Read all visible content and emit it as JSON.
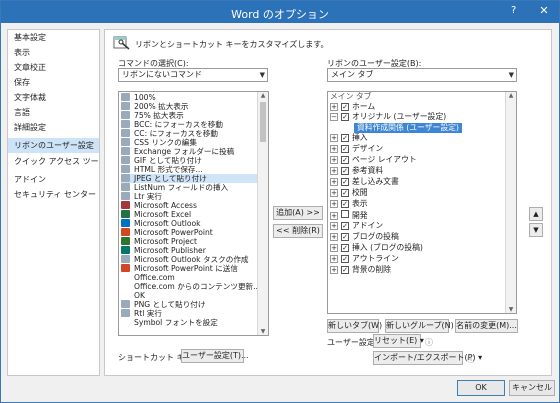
{
  "window": {
    "title": "Word のオプション",
    "help_icon": "?",
    "close_icon": "✕"
  },
  "sidebar": {
    "items": [
      {
        "label": "基本設定"
      },
      {
        "label": "表示"
      },
      {
        "label": "文章校正"
      },
      {
        "label": "保存"
      },
      {
        "label": "文字体裁"
      },
      {
        "label": "言語"
      },
      {
        "label": "詳細設定"
      },
      {
        "label": "リボンのユーザー設定",
        "selected": true
      },
      {
        "label": "クイック アクセス ツール バー"
      },
      {
        "label": "アドイン"
      },
      {
        "label": "セキュリティ センター"
      }
    ]
  },
  "header": {
    "description": "リボンとショートカット キーをカスタマイズします。"
  },
  "left_panel": {
    "label": "コマンドの選択(C):",
    "dropdown_value": "リボンにないコマンド",
    "commands": [
      "100%",
      "200% 拡大表示",
      "75% 拡大表示",
      "BCC: にフォーカスを移動",
      "CC: にフォーカスを移動",
      "CSS リンクの編集",
      "Exchange フォルダーに投稿",
      "GIF として貼り付け",
      "HTML 形式で保存...",
      "JPEG として貼り付け",
      "ListNum フィールドの挿入",
      "Ltr 実行",
      "Microsoft Access",
      "Microsoft Excel",
      "Microsoft Outlook",
      "Microsoft PowerPoint",
      "Microsoft Project",
      "Microsoft Publisher",
      "Microsoft Outlook タスクの作成",
      "Microsoft PowerPoint に送信",
      "Office.com",
      "Office.com からのコンテンツ更新...",
      "OK",
      "PNG として貼り付け",
      "Rtl 実行",
      "Symbol フォントを設定"
    ],
    "selected_index": 9,
    "shortcut_label": "ショートカット キー:",
    "shortcut_button": "ユーザー設定(T)..."
  },
  "middle": {
    "add_button": "追加(A) >>",
    "remove_button": "<< 削除(R)"
  },
  "right_panel": {
    "label": "リボンのユーザー設定(B):",
    "dropdown_value": "メイン タブ",
    "tree_header": "メイン タブ",
    "tree": [
      {
        "label": "ホーム",
        "level": 0,
        "expander": "+",
        "checked": true
      },
      {
        "label": "オリジナル (ユーザー設定)",
        "level": 0,
        "expander": "−",
        "checked": true
      },
      {
        "label": "資料作成関係 (ユーザー設定)",
        "level": 1,
        "selected": true
      },
      {
        "label": "挿入",
        "level": 0,
        "expander": "+",
        "checked": true
      },
      {
        "label": "デザイン",
        "level": 0,
        "expander": "+",
        "checked": true
      },
      {
        "label": "ページ レイアウト",
        "level": 0,
        "expander": "+",
        "checked": true
      },
      {
        "label": "参考資料",
        "level": 0,
        "expander": "+",
        "checked": true
      },
      {
        "label": "差し込み文書",
        "level": 0,
        "expander": "+",
        "checked": true
      },
      {
        "label": "校閲",
        "level": 0,
        "expander": "+",
        "checked": true
      },
      {
        "label": "表示",
        "level": 0,
        "expander": "+",
        "checked": true
      },
      {
        "label": "開発",
        "level": 0,
        "expander": "+",
        "checked": false
      },
      {
        "label": "アドイン",
        "level": 0,
        "expander": "+",
        "checked": true
      },
      {
        "label": "ブログの投稿",
        "level": 0,
        "expander": "+",
        "checked": true
      },
      {
        "label": "挿入 (ブログの投稿)",
        "level": 0,
        "expander": "+",
        "checked": true
      },
      {
        "label": "アウトライン",
        "level": 0,
        "expander": "+",
        "checked": true
      },
      {
        "label": "背景の削除",
        "level": 0,
        "expander": "+",
        "checked": true
      }
    ],
    "new_tab_button": "新しいタブ(W)",
    "new_group_button": "新しいグループ(N)",
    "rename_button": "名前の変更(M)...",
    "user_settings_label": "ユーザー設定:",
    "reset_button": "リセット(E) ▾",
    "import_export_button": "インポート/エクスポート(P) ▾",
    "info_icon": "ⓘ",
    "move_up_icon": "▲",
    "move_down_icon": "▼"
  },
  "footer": {
    "ok_button": "OK",
    "cancel_button": "キャンセル"
  }
}
